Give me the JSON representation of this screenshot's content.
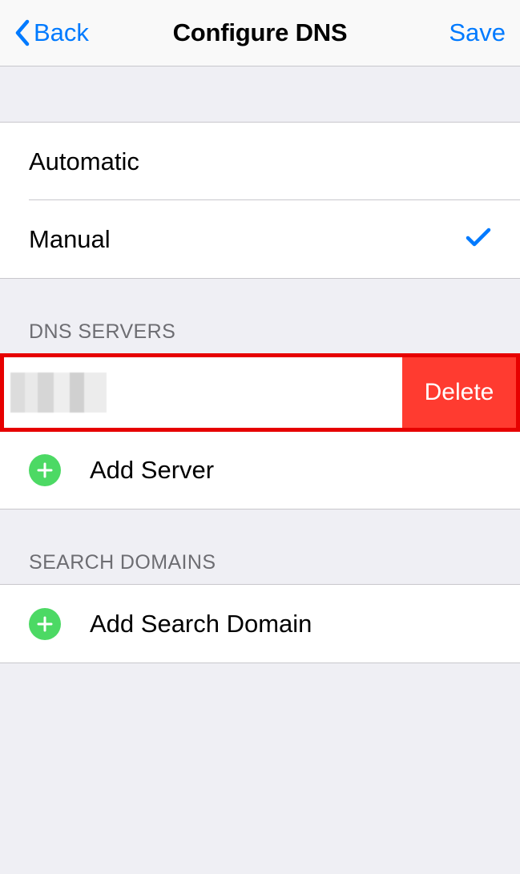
{
  "nav": {
    "back": "Back",
    "title": "Configure DNS",
    "save": "Save"
  },
  "modes": {
    "automatic": "Automatic",
    "manual": "Manual",
    "selected": "manual"
  },
  "dns": {
    "header": "DNS SERVERS",
    "server_value_redacted": true,
    "delete_label": "Delete",
    "add_label": "Add Server"
  },
  "search_domains": {
    "header": "SEARCH DOMAINS",
    "add_label": "Add Search Domain"
  },
  "colors": {
    "accent": "#007AFF",
    "delete": "#FF3B30",
    "add": "#4CD964",
    "highlight_border": "#E60000"
  }
}
